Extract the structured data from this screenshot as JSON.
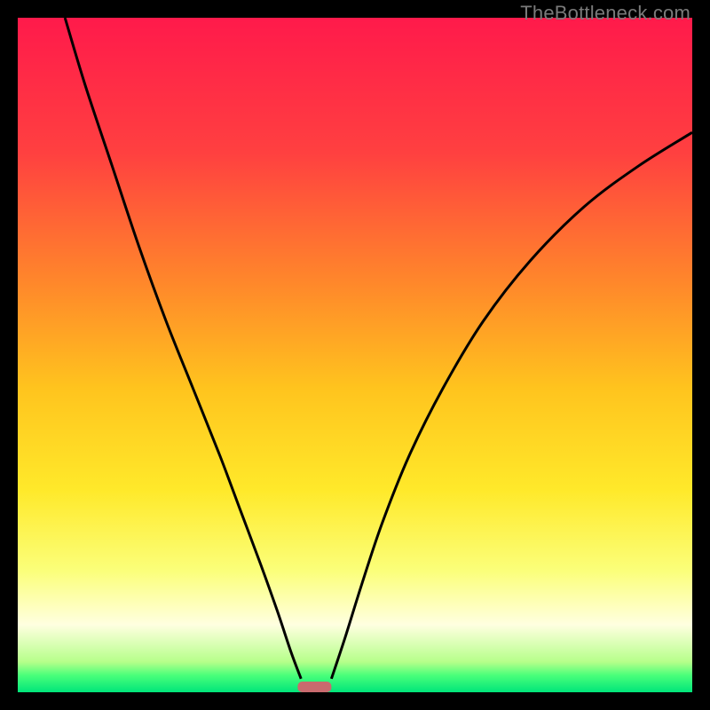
{
  "watermark": "TheBottleneck.com",
  "chart_data": {
    "type": "line",
    "title": "",
    "xlabel": "",
    "ylabel": "",
    "xlim": [
      0,
      100
    ],
    "ylim": [
      0,
      100
    ],
    "background_gradient": {
      "stops": [
        {
          "pos": 0.0,
          "color": "#ff1a4b"
        },
        {
          "pos": 0.2,
          "color": "#ff4040"
        },
        {
          "pos": 0.4,
          "color": "#ff8a2a"
        },
        {
          "pos": 0.55,
          "color": "#ffc41e"
        },
        {
          "pos": 0.7,
          "color": "#ffe92a"
        },
        {
          "pos": 0.82,
          "color": "#fbff7a"
        },
        {
          "pos": 0.9,
          "color": "#ffffe0"
        },
        {
          "pos": 0.955,
          "color": "#b6ff8a"
        },
        {
          "pos": 0.975,
          "color": "#49ff7a"
        },
        {
          "pos": 1.0,
          "color": "#00e57a"
        }
      ]
    },
    "series": [
      {
        "name": "left-curve",
        "description": "Descending curve from top-left toward minimum",
        "points": [
          {
            "x": 7.0,
            "y": 100.0
          },
          {
            "x": 10.0,
            "y": 90.0
          },
          {
            "x": 14.0,
            "y": 78.0
          },
          {
            "x": 18.0,
            "y": 66.0
          },
          {
            "x": 22.0,
            "y": 55.0
          },
          {
            "x": 26.0,
            "y": 45.0
          },
          {
            "x": 30.0,
            "y": 35.0
          },
          {
            "x": 33.0,
            "y": 27.0
          },
          {
            "x": 36.0,
            "y": 19.0
          },
          {
            "x": 38.5,
            "y": 12.0
          },
          {
            "x": 40.5,
            "y": 6.0
          },
          {
            "x": 42.0,
            "y": 2.0
          }
        ]
      },
      {
        "name": "right-curve",
        "description": "Ascending curve from minimum toward top-right",
        "points": [
          {
            "x": 46.5,
            "y": 2.0
          },
          {
            "x": 48.5,
            "y": 8.0
          },
          {
            "x": 51.0,
            "y": 16.0
          },
          {
            "x": 54.0,
            "y": 25.0
          },
          {
            "x": 58.0,
            "y": 35.0
          },
          {
            "x": 63.0,
            "y": 45.0
          },
          {
            "x": 69.0,
            "y": 55.0
          },
          {
            "x": 76.0,
            "y": 64.0
          },
          {
            "x": 84.0,
            "y": 72.0
          },
          {
            "x": 92.0,
            "y": 78.0
          },
          {
            "x": 100.0,
            "y": 83.0
          }
        ]
      }
    ],
    "marker": {
      "name": "optimal-range",
      "x_center": 44.0,
      "width": 5.0,
      "color": "#c96a6e"
    }
  }
}
